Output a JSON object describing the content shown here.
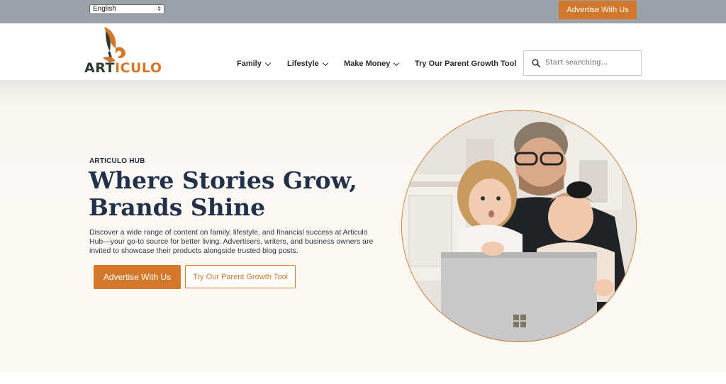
{
  "topbar": {
    "language": "English",
    "advertise_label": "Advertise With Us"
  },
  "header": {
    "logo": {
      "part1": "ART",
      "part2": "ICULO"
    },
    "nav": [
      {
        "label": "Family",
        "has_dropdown": true
      },
      {
        "label": "Lifestyle",
        "has_dropdown": true
      },
      {
        "label": "Make Money",
        "has_dropdown": true
      },
      {
        "label": "Try Our Parent Growth Tool",
        "has_dropdown": false
      }
    ],
    "search": {
      "placeholder": "Start searching..."
    }
  },
  "hero": {
    "eyebrow": "ARTICULO HUB",
    "headline_line1": "Where Stories Grow,",
    "headline_line2": "Brands Shine",
    "description": "Discover a wide range of content on family, lifestyle, and financial success at Articulo Hub—your go-to source for better living. Advertisers, writers, and business owners are invited to showcase their products alongside trusted blog posts.",
    "primary_button": "Advertise With Us",
    "secondary_button": "Try Our Parent Growth Tool"
  },
  "colors": {
    "accent": "#d3782a",
    "topbar": "#9aa1a8",
    "heading": "#223049",
    "hero_bg": "#fcf9f5"
  }
}
